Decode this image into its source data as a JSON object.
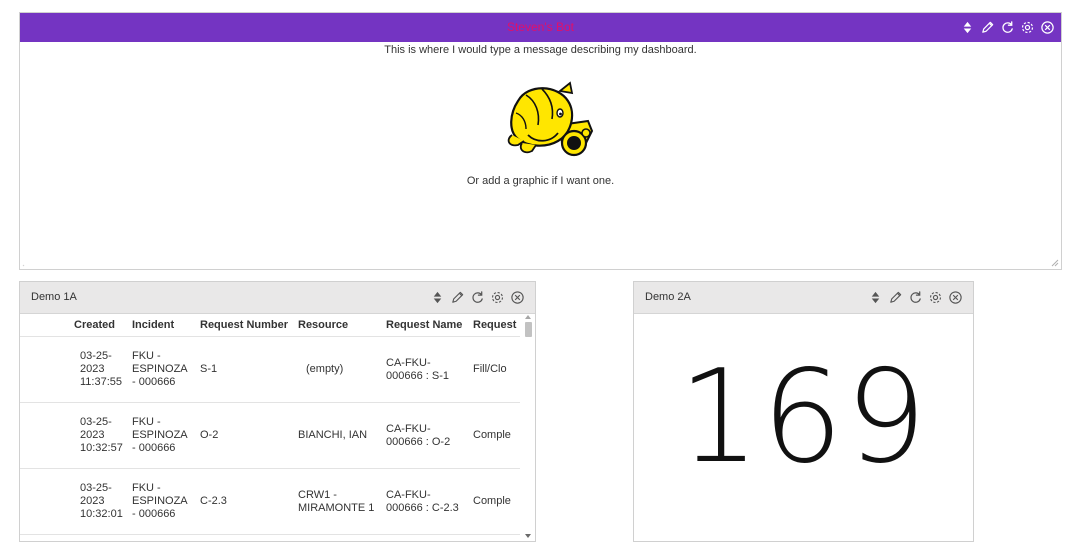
{
  "colors": {
    "accent_purple": "#7434c2",
    "title_pink": "#e0106a",
    "link_blue": "#4f6ecf",
    "header_grey": "#e9e8e8"
  },
  "top_panel": {
    "title": "Steven's Bot",
    "message": "This is where I would type a message describing my dashboard.",
    "graphic_caption": "Or add a graphic if I want one.",
    "tools": [
      "sort-icon",
      "edit-icon",
      "refresh-icon",
      "settings-icon",
      "close-icon"
    ]
  },
  "demo1a": {
    "title": "Demo 1A",
    "columns": [
      "Created",
      "Incident",
      "Request Number",
      "Resource",
      "Request Name",
      "Request"
    ],
    "rows": [
      {
        "created": "03-25-2023 11:37:55",
        "incident": "FKU - ESPINOZA - 000666",
        "request_number": "S-1",
        "resource": "(empty)",
        "resource_link": false,
        "request_name": "CA-FKU-000666 : S-1",
        "request": "Fill/Clo"
      },
      {
        "created": "03-25-2023 10:32:57",
        "incident": "FKU - ESPINOZA - 000666",
        "request_number": "O-2",
        "resource": "BIANCHI, IAN",
        "resource_link": true,
        "request_name": "CA-FKU-000666 : O-2",
        "request": "Comple"
      },
      {
        "created": "03-25-2023 10:32:01",
        "incident": "FKU - ESPINOZA - 000666",
        "request_number": "C-2.3",
        "resource": "CRW1 - MIRAMONTE 1",
        "resource_link": true,
        "request_name": "CA-FKU-000666 : C-2.3",
        "request": "Comple"
      }
    ]
  },
  "demo2a": {
    "title": "Demo 2A",
    "value": "169"
  }
}
